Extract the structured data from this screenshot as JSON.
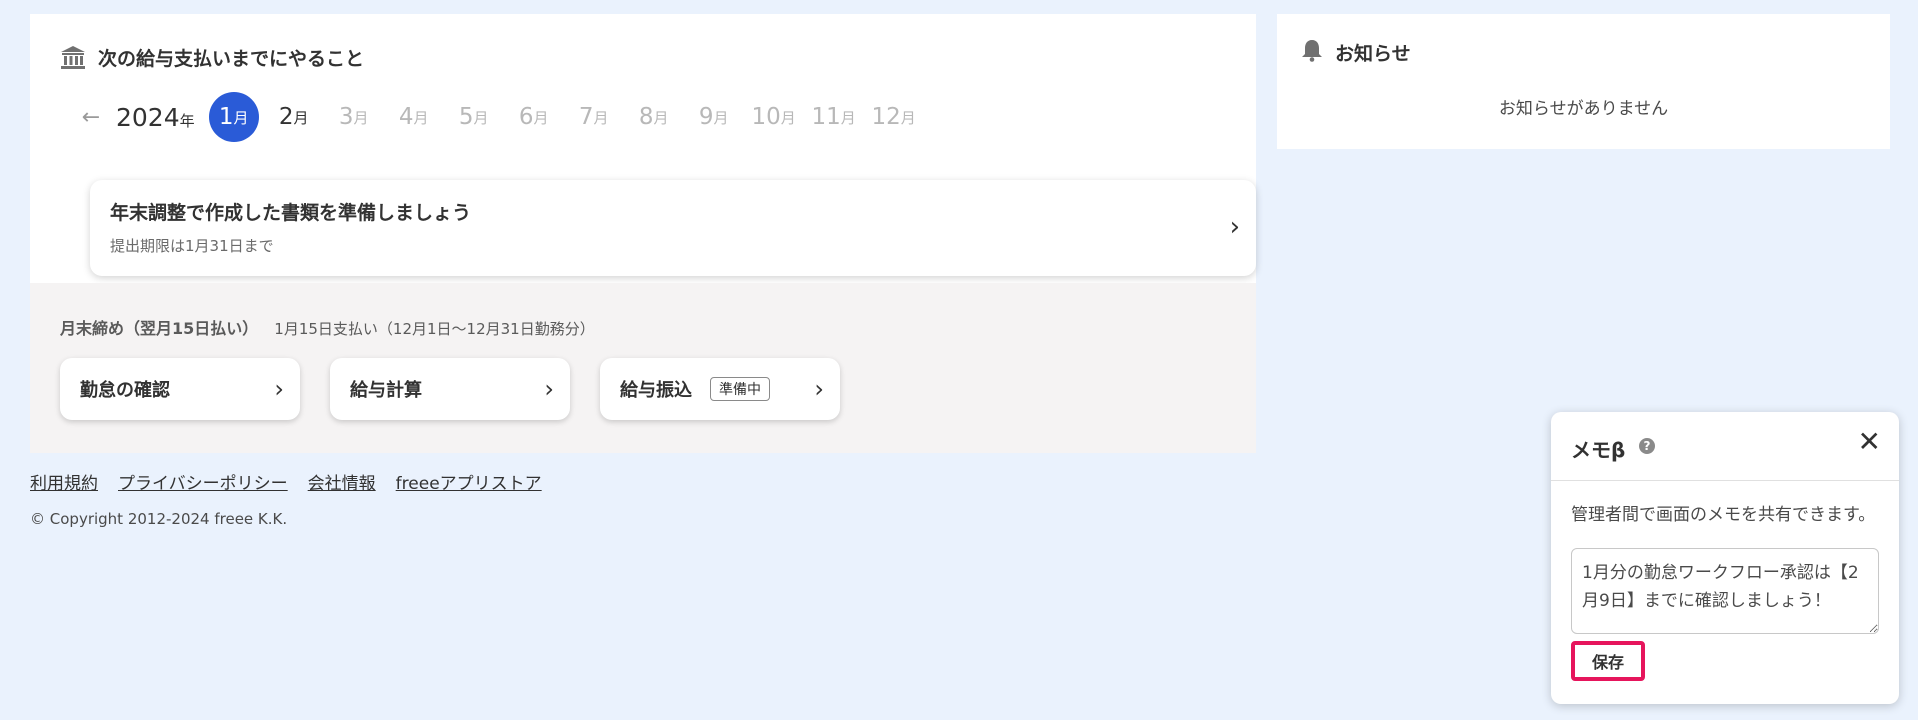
{
  "todo": {
    "title": "次の給与支払いまでにやること",
    "year": "2024",
    "year_unit": "年",
    "months": [
      {
        "num": "1",
        "unit": "月",
        "state": "active"
      },
      {
        "num": "2",
        "unit": "月",
        "state": "near"
      },
      {
        "num": "3",
        "unit": "月",
        "state": "future"
      },
      {
        "num": "4",
        "unit": "月",
        "state": "future"
      },
      {
        "num": "5",
        "unit": "月",
        "state": "future"
      },
      {
        "num": "6",
        "unit": "月",
        "state": "future"
      },
      {
        "num": "7",
        "unit": "月",
        "state": "future"
      },
      {
        "num": "8",
        "unit": "月",
        "state": "future"
      },
      {
        "num": "9",
        "unit": "月",
        "state": "future"
      },
      {
        "num": "10",
        "unit": "月",
        "state": "future"
      },
      {
        "num": "11",
        "unit": "月",
        "state": "future"
      },
      {
        "num": "12",
        "unit": "月",
        "state": "future"
      }
    ],
    "task": {
      "title": "年末調整で作成した書類を準備しましょう",
      "deadline": "提出期限は1月31日まで"
    }
  },
  "payroll": {
    "closing": "月末締め（翌月15日払い）",
    "period": "1月15日支払い（12月1日〜12月31日勤務分）",
    "steps": [
      {
        "label": "勤怠の確認"
      },
      {
        "label": "給与計算"
      },
      {
        "label": "給与振込",
        "badge": "準備中"
      }
    ]
  },
  "footer": {
    "links": [
      "利用規約",
      "プライバシーポリシー",
      "会社情報",
      "freeeアプリストア"
    ],
    "copyright": "© Copyright 2012-2024 freee K.K."
  },
  "notice": {
    "title": "お知らせ",
    "empty": "お知らせがありません"
  },
  "memo": {
    "title": "メモβ",
    "description": "管理者間で画面のメモを共有できます。",
    "text": "1月分の勤怠ワークフロー承認は【2月9日】までに確認しましょう！",
    "save_label": "保存"
  },
  "colors": {
    "background": "#eaf2fd",
    "accent": "#2a5bd7",
    "highlight": "#e6155c"
  }
}
